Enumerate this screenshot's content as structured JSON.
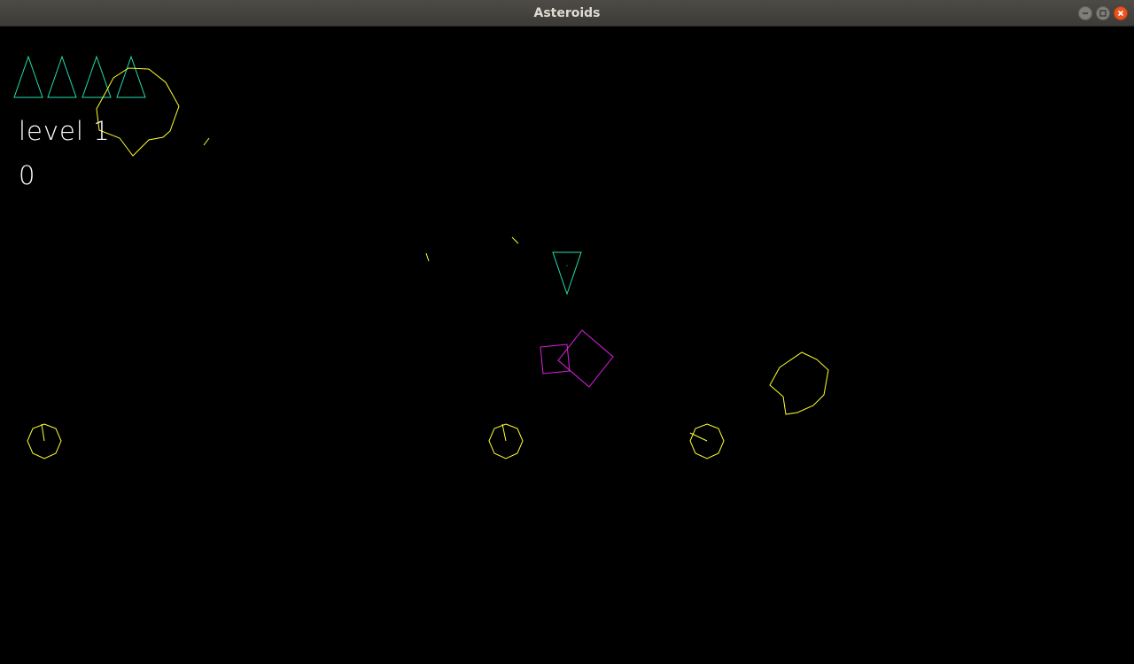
{
  "window": {
    "title": "Asteroids",
    "controls": [
      "minimize",
      "maximize",
      "close"
    ]
  },
  "hud": {
    "lives": 4,
    "level_label": "level",
    "level_value": "1",
    "score": "0"
  },
  "colors": {
    "background": "#000000",
    "ship": "#20e0b0",
    "asteroid": "#ffff30",
    "enemy": "#e020e0",
    "text": "#ffffff",
    "close_button": "#e95420"
  },
  "icons": {
    "minimize": "minimize-icon",
    "maximize": "maximize-icon",
    "close": "close-icon",
    "life": "ship-life-icon"
  }
}
